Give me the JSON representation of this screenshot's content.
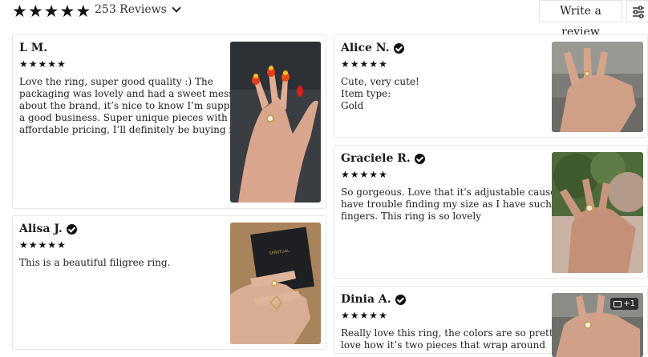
{
  "header": {
    "rating_stars": 5,
    "review_count_label": "253 Reviews",
    "write_review_label": "Write a review",
    "filter_icon": "sliders-icon"
  },
  "reviews": [
    {
      "name": "L M.",
      "verified": false,
      "stars": 5,
      "text": "Love the ring, super good quality :) The\npackaging was lovely and had a sweet message\nabout the brand, it’s nice to know I’m supporting\na good business. Super unique pieces with\naffordable pricing, I’ll definitely be buying more!"
    },
    {
      "name": "Alisa J.",
      "verified": true,
      "stars": 5,
      "text": "This is a beautiful filigree ring."
    },
    {
      "name": "Alice N.",
      "verified": true,
      "stars": 5,
      "text": "Cute, very cute!\nItem type:\nGold"
    },
    {
      "name": "Graciele R.",
      "verified": true,
      "stars": 5,
      "text": "So gorgeous. Love that it's adjustable cause I\nhave trouble finding my size as I have such thin\nfingers. This ring is so lovely"
    },
    {
      "name": "Dinia A.",
      "verified": true,
      "stars": 5,
      "text": "Really love this ring, the colors are so pretty and I\nlove how it’s two pieces that wrap around",
      "more_photos": "+1"
    }
  ]
}
